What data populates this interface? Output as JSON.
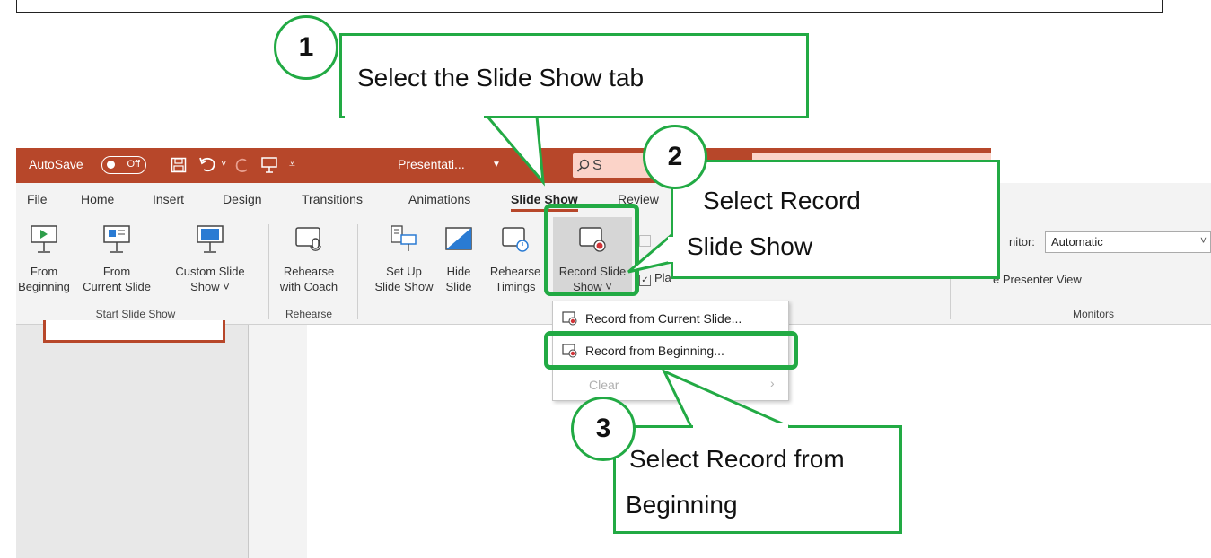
{
  "titlebar": {
    "autosave": "AutoSave",
    "toggle": "Off",
    "doc_title": "Presentati...",
    "search_placeholder": "S",
    "colors": {
      "bar": "#b7472a",
      "search": "#fbd3c8"
    }
  },
  "tabs": [
    "File",
    "Home",
    "Insert",
    "Design",
    "Transitions",
    "Animations",
    "Slide Show",
    "Review"
  ],
  "ribbon": {
    "from_beginning": [
      "From",
      "Beginning"
    ],
    "from_current": [
      "From",
      "Current Slide"
    ],
    "custom_slide_show": [
      "Custom Slide",
      "Show ˅"
    ],
    "group_start": "Start Slide Show",
    "rehearse_coach": [
      "Rehearse",
      "with Coach"
    ],
    "group_rehearse": "Rehearse",
    "set_up": [
      "Set Up",
      "Slide Show"
    ],
    "hide_slide": [
      "Hide",
      "Slide"
    ],
    "rehearse_timings": [
      "Rehearse",
      "Timings"
    ],
    "record_slide_show": [
      "Record Slide",
      "Show ˅"
    ],
    "play_check": "Pla",
    "monitor_label": "nitor:",
    "monitor_value": "Automatic",
    "presenter_view": "e Presenter View",
    "group_monitors": "Monitors"
  },
  "menu": {
    "items": [
      {
        "label": "Record from Current Slide...",
        "enabled": true
      },
      {
        "label": "Record from Beginning...",
        "enabled": true
      },
      {
        "label": "Clear",
        "enabled": false
      }
    ]
  },
  "callouts": {
    "c1": {
      "num": "1",
      "text": "Select the Slide Show tab"
    },
    "c2": {
      "num": "2",
      "text_l1": "Select Record",
      "text_l2": "Slide Show"
    },
    "c3": {
      "num": "3",
      "text_l1": "Select Record from",
      "text_l2": "Beginning"
    },
    "color": "#22aa44"
  }
}
